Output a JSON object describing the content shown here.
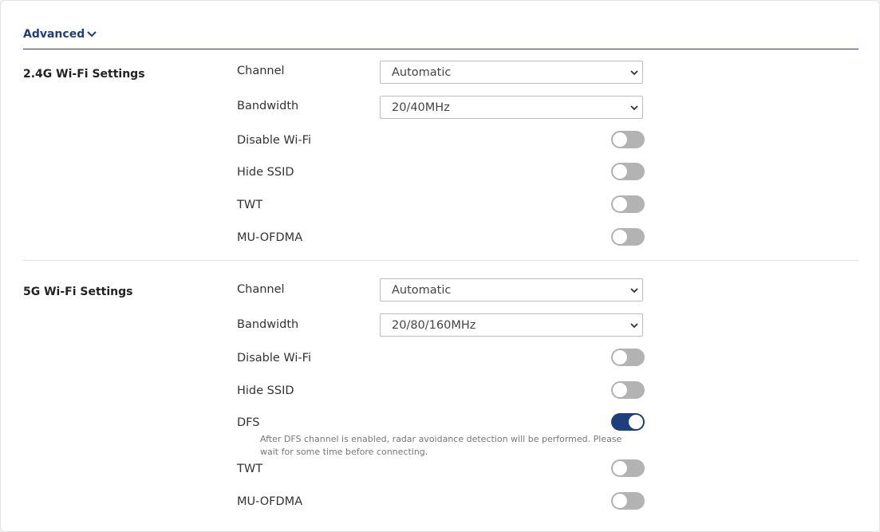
{
  "advanced": {
    "label": "Advanced",
    "icon": "chevron-down-icon"
  },
  "sec24": {
    "title": "2.4G Wi-Fi Settings",
    "channel_label": "Channel",
    "channel_value": "Automatic",
    "bandwidth_label": "Bandwidth",
    "bandwidth_value": "20/40MHz",
    "disable_wifi_label": "Disable Wi-Fi",
    "disable_wifi_on": false,
    "hide_ssid_label": "Hide SSID",
    "hide_ssid_on": false,
    "twt_label": "TWT",
    "twt_on": false,
    "mu_ofdma_label": "MU-OFDMA",
    "mu_ofdma_on": false
  },
  "sec5": {
    "title": "5G Wi-Fi Settings",
    "channel_label": "Channel",
    "channel_value": "Automatic",
    "bandwidth_label": "Bandwidth",
    "bandwidth_value": "20/80/160MHz",
    "disable_wifi_label": "Disable Wi-Fi",
    "disable_wifi_on": false,
    "hide_ssid_label": "Hide SSID",
    "hide_ssid_on": false,
    "dfs_label": "DFS",
    "dfs_on": true,
    "dfs_note": "After DFS channel is enabled, radar avoidance detection will be performed. Please wait for some time before connecting.",
    "twt_label": "TWT",
    "twt_on": false,
    "mu_ofdma_label": "MU-OFDMA",
    "mu_ofdma_on": false
  },
  "colors": {
    "accent": "#1e3e7e",
    "toggle_off": "#b3b3b3"
  }
}
